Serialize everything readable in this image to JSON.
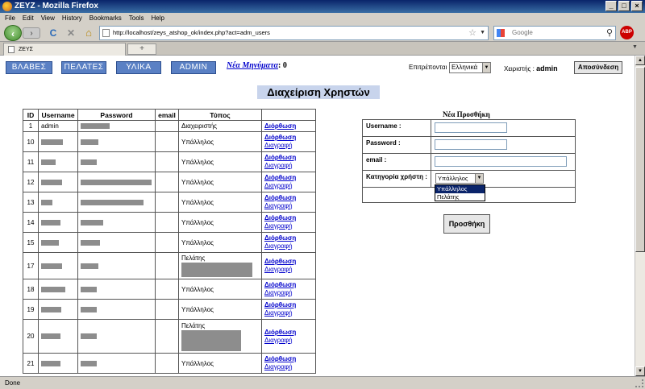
{
  "window": {
    "title": "ZEYZ - Mozilla Firefox",
    "controls": [
      "_",
      "□",
      "×"
    ]
  },
  "menu": [
    "File",
    "Edit",
    "View",
    "History",
    "Bookmarks",
    "Tools",
    "Help"
  ],
  "nav": {
    "back": "‹",
    "forward": "›",
    "reload": "C",
    "stop": "✕",
    "home": "⌂",
    "url": "http://localhost/zeys_atshop_ok/index.php?act=adm_users",
    "search_placeholder": "Google",
    "addon": "ABP"
  },
  "tab": {
    "label": "ΖΕΥΣ",
    "new": "+"
  },
  "site": {
    "nav_buttons": [
      "ΒΛΑΒΕΣ",
      "ΠΕΛΑΤΕΣ",
      "ΥΛΙΚΑ",
      "ADMIN"
    ],
    "new_messages_label": "Νέα Μηνύματα",
    "new_messages_count": ": 0",
    "allowed_label": "Επιτρέπονται :",
    "language": "Ελληνικά",
    "operator_label": "Χειριστής :",
    "operator": "admin",
    "logout": "Αποσύνδεση"
  },
  "page_title": "Διαχείριση Χρηστών",
  "users_table": {
    "headers": [
      "ID",
      "Username",
      "Password",
      "email",
      "Τύπος",
      ""
    ],
    "action_edit": "Διόρθωση",
    "action_delete": "Διαγραφή",
    "rows": [
      {
        "id": "1",
        "username": "admin",
        "type": "Διαχειριστής"
      },
      {
        "id": "10",
        "type": "Υπάλληλος"
      },
      {
        "id": "11",
        "type": "Υπάλληλος"
      },
      {
        "id": "12",
        "type": "Υπάλληλος"
      },
      {
        "id": "13",
        "type": "Υπάλληλος"
      },
      {
        "id": "14",
        "type": "Υπάλληλος"
      },
      {
        "id": "15",
        "type": "Υπάλληλος"
      },
      {
        "id": "17",
        "type": "Πελάτης"
      },
      {
        "id": "18",
        "type": "Υπάλληλος"
      },
      {
        "id": "19",
        "type": "Υπάλληλος"
      },
      {
        "id": "20",
        "type": "Πελάτης"
      },
      {
        "id": "21",
        "type": "Υπάλληλος"
      }
    ]
  },
  "add_form": {
    "title": "Νέα Προσθήκη",
    "username_label": "Username :",
    "password_label": "Password :",
    "email_label": "email :",
    "category_label": "Κατηγορία χρήστη :",
    "category_selected": "Υπάλληλος",
    "category_options": [
      "Υπάλληλος",
      "Πελάτης"
    ],
    "submit": "Προσθήκη"
  },
  "status": "Done",
  "colors": {
    "nav_button": "#5a80c4",
    "title_highlight": "#c8d4ec",
    "link": "#0000cc"
  }
}
